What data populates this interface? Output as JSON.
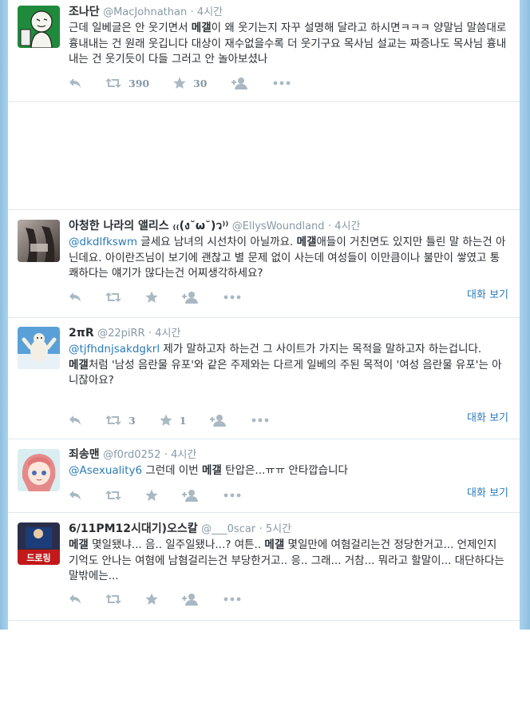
{
  "tweets": [
    {
      "fullname": "조나단",
      "username": "@MacJohnathan",
      "time": "· 4시간",
      "segments": [
        {
          "t": "근데 일베글은 안 웃기면서 "
        },
        {
          "t": "메갤",
          "kw": true
        },
        {
          "t": "이 왜 웃기는지 자꾸 설명해 달라고 하시면ㅋㅋㅋ 양말님 말씀대로 흉내내는 건 원래 웃깁니다 대상이 재수없을수록 더 웃기구요 목사님 설교는 짜증나도 목사님 흉내내는 건 웃기듯이 다들 그러고 안 놀아보셨나"
        }
      ],
      "retweets": "390",
      "favorites": "30",
      "conversation": ""
    },
    {
      "fullname": "아청한 나라의 앨리스 ₍₍(ง˘ω˘)ว⁾⁾",
      "username": "@EllysWoundland",
      "time": "· 4시간",
      "segments": [
        {
          "t": "@dkdlfkswm",
          "mention": true
        },
        {
          "t": " 글세요 남녀의 시선차이 아닐까요. "
        },
        {
          "t": "메갤",
          "kw": true
        },
        {
          "t": "애들이 거친면도 있지만 틀린 말 하는건 아닌데요. 아이란즈님이 보기에 괜찮고 별 문제 없이 사는데 여성들이 이만큼이나 불만이 쌓였고 통쾌하다는 얘기가 많다는건 어찌생각하세요?"
        }
      ],
      "retweets": "",
      "favorites": "",
      "conversation": "대화 보기"
    },
    {
      "fullname": "2πR",
      "username": "@22piRR",
      "time": "· 4시간",
      "segments": [
        {
          "t": "@tjfhdnjsakdgkrl",
          "mention": true
        },
        {
          "t": " 제가 말하고자 하는건 그 사이트가 가지는 목적을 말하고자 하는겁니다."
        },
        {
          "br": true
        },
        {
          "t": "메갤",
          "kw": true
        },
        {
          "t": "처럼 '남성 음란물 유포'와 같은 주제와는 다르게 일베의 주된 목적이 '여성 음란물 유포'는 아니잖아요?"
        }
      ],
      "retweets": "3",
      "favorites": "1",
      "conversation": "대화 보기"
    },
    {
      "fullname": "죄송맨",
      "username": "@f0rd0252",
      "time": "· 4시간",
      "segments": [
        {
          "t": "@Asexuality6",
          "mention": true
        },
        {
          "t": " 그런데 이번 "
        },
        {
          "t": "메갤",
          "kw": true
        },
        {
          "t": " 탄압은...ㅠㅠ 안타깝습니다"
        }
      ],
      "retweets": "",
      "favorites": "",
      "conversation": "대화 보기"
    },
    {
      "fullname": "6/11PM12시대기)오스칼",
      "username": "@___0scar",
      "time": "· 5시간",
      "segments": [
        {
          "t": "메갤",
          "kw": true
        },
        {
          "t": " 몇일됐냐... 음.. 일주일됐나...? 여튼.. "
        },
        {
          "t": "메갤",
          "kw": true
        },
        {
          "t": " 몇일만에 여혐걸리는건 정당한거고... 언제인지 기억도 안나는 여혐에 남혐걸리는건 부당한거고.. 응.. 그래... 거참... 뭐라고 할말이... 대단하다는 말밖에는..."
        }
      ],
      "retweets": "",
      "favorites": "",
      "conversation": ""
    }
  ],
  "avatar5_text": "드로링",
  "colors": {
    "link": "#2b7bb9",
    "icon": "#aab8c2",
    "muted": "#8899a6",
    "divider": "#e1e8ed",
    "side": "#a9d2ec"
  },
  "icons": [
    "reply-icon",
    "retweet-icon",
    "favorite-icon",
    "follow-icon",
    "more-icon"
  ]
}
